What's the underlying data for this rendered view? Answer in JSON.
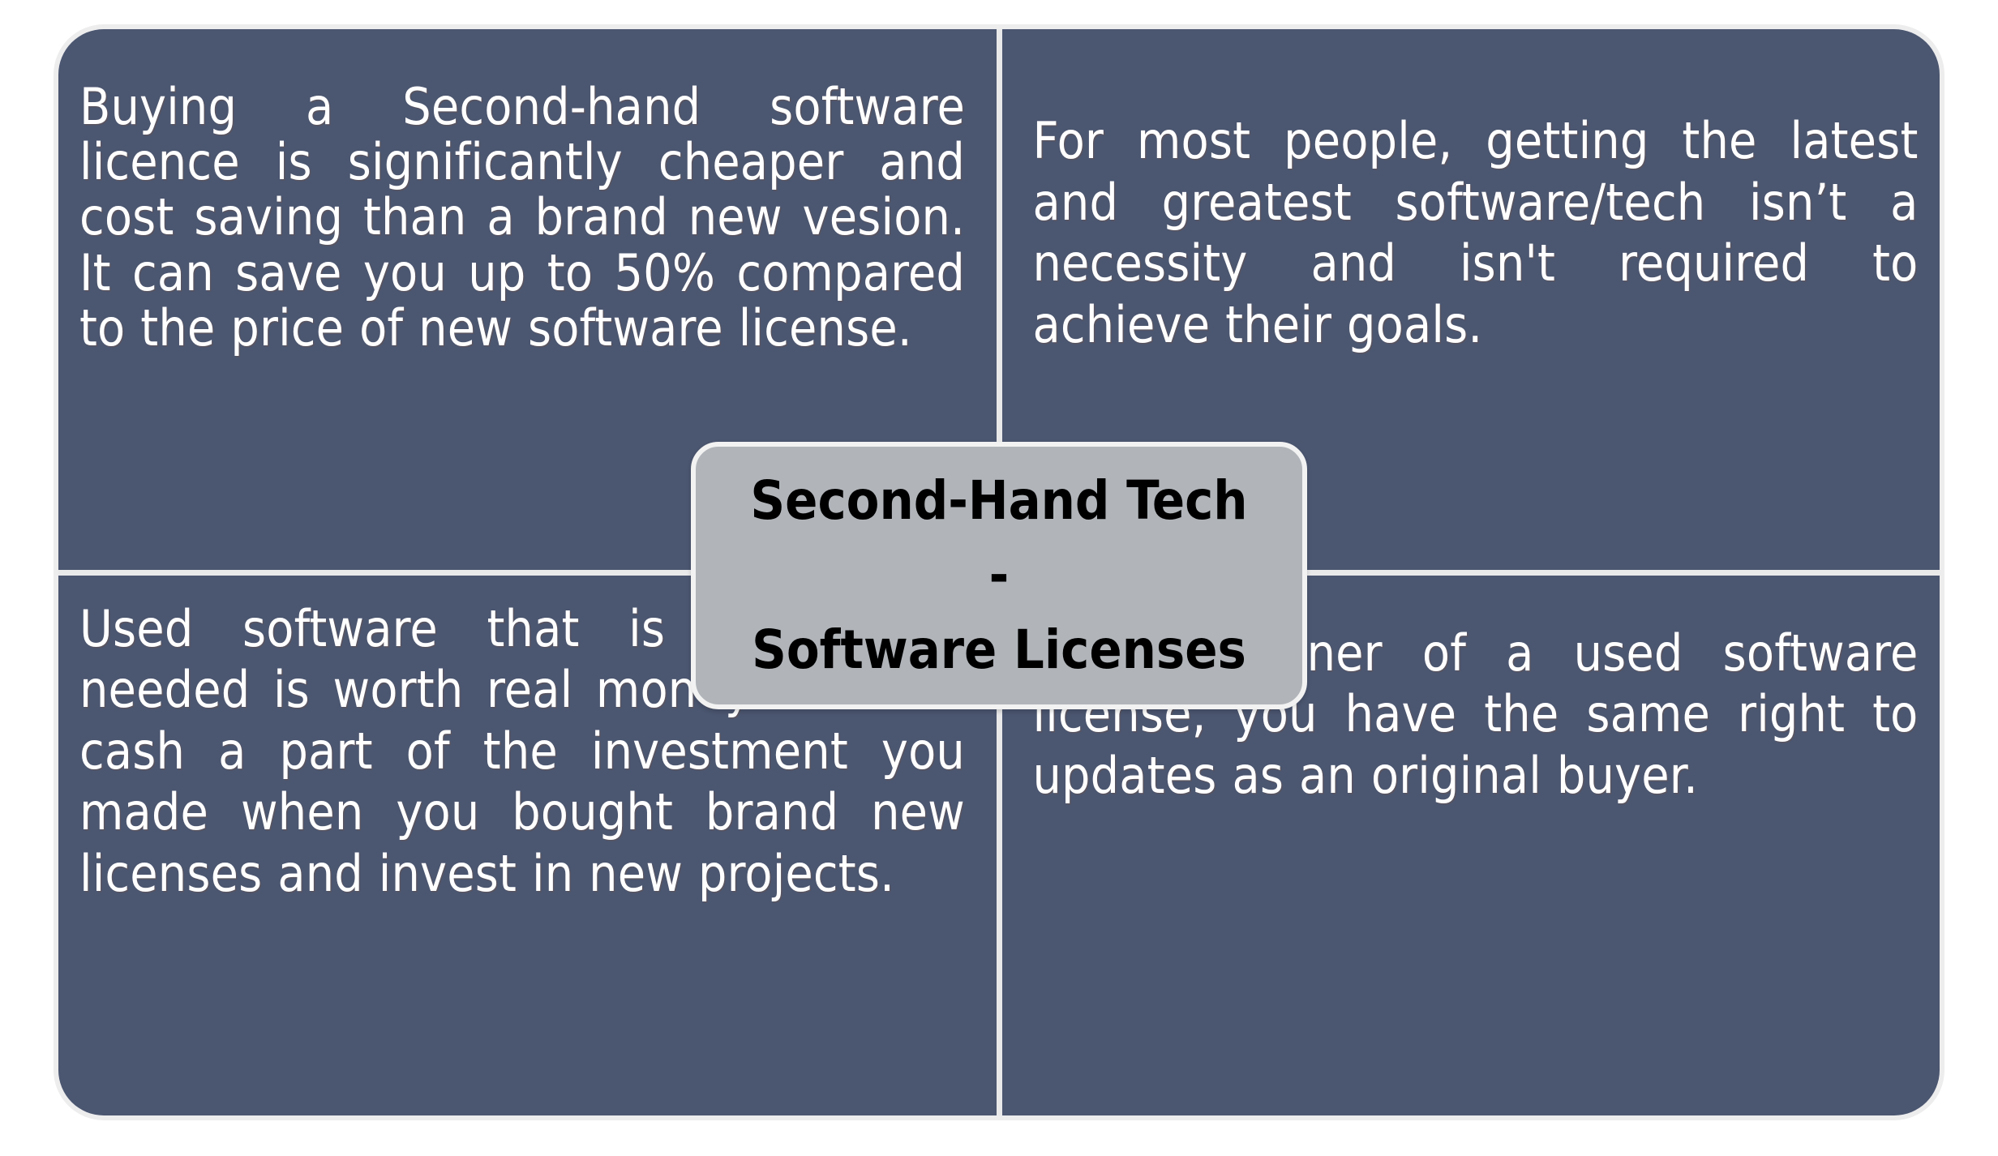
{
  "diagram": {
    "type": "four-quadrant-matrix",
    "title": "Second-Hand Tech - Software Licenses",
    "colors": {
      "quadrant_background": "#4b5670",
      "quadrant_text": "#ffffff",
      "center_box_fill": "#b1b5ba",
      "center_box_border": "#f2f2f2",
      "center_box_text": "#000000",
      "divider": "#e9e9ea",
      "page_background": "#ffffff"
    },
    "center": {
      "line1": "Second-Hand Tech",
      "dash": "-",
      "line2": "Software Licenses"
    },
    "quadrants": [
      {
        "position": "top-left",
        "text": "Buying a Second-hand software licence is significantly cheaper and cost saving than a brand new vesion. It can save you up to 50% compared to the price of new software license."
      },
      {
        "position": "top-right",
        "text": "For most people, getting the latest and greatest software/tech isn’t a necessity and isn't required to achieve their goals."
      },
      {
        "position": "bottom-left",
        "text": "Used software that is no longer needed is worth real money. You can cash a part of the investment you made when you bought brand new licenses and invest in new projects."
      },
      {
        "position": "bottom-right",
        "text": "As the owner of a used software license, you have the same right to updates as an original buyer."
      }
    ]
  }
}
